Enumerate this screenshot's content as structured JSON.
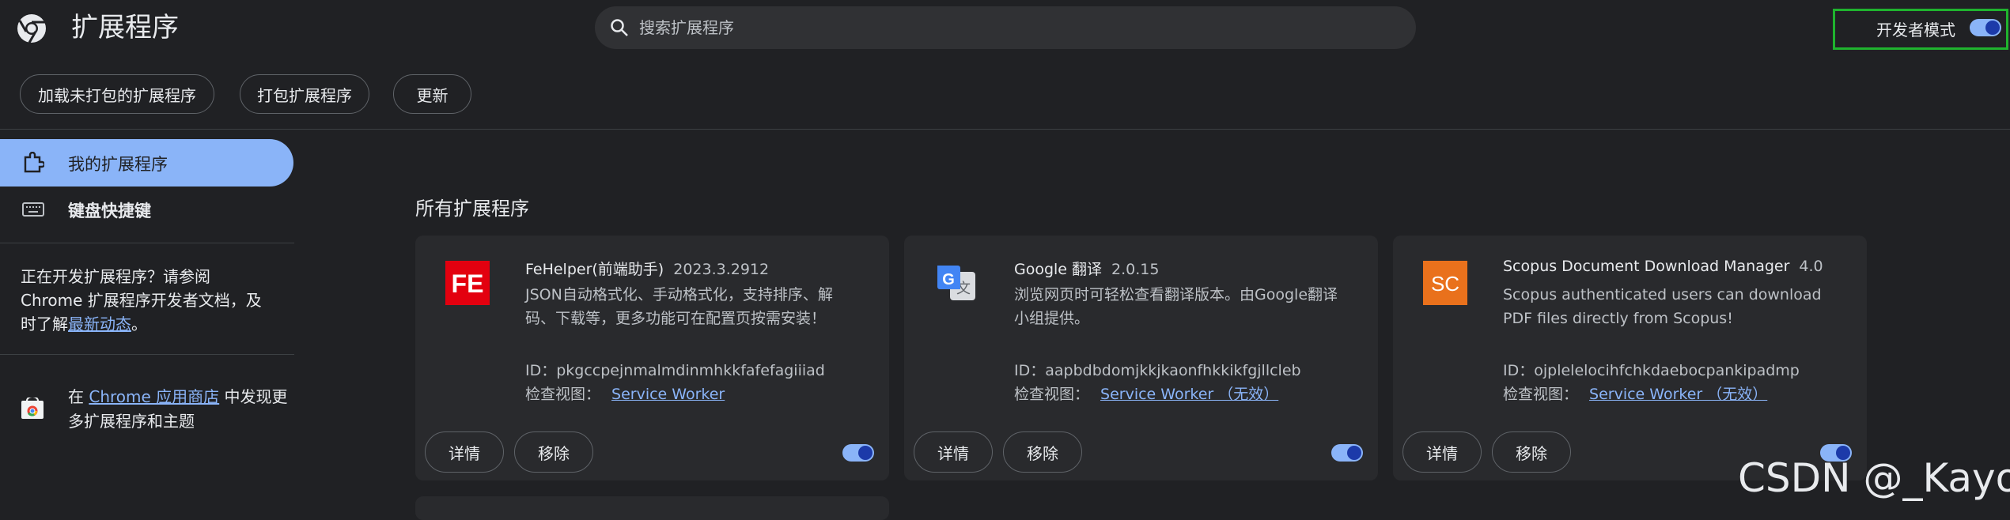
{
  "header": {
    "title": "扩展程序",
    "search_placeholder": "搜索扩展程序",
    "dev_mode_label": "开发者模式",
    "dev_mode_on": true
  },
  "toolbar": {
    "load_unpacked": "加载未打包的扩展程序",
    "pack": "打包扩展程序",
    "update": "更新"
  },
  "sidebar": {
    "items": [
      {
        "label": "我的扩展程序",
        "active": true
      },
      {
        "label": "键盘快捷键",
        "active": false
      }
    ],
    "dev_text_pre": "正在开发扩展程序？请参阅 Chrome 扩展程序开发者文档，及时了解",
    "dev_link": "最新动态",
    "dev_text_post": "。",
    "store_pre": "在 ",
    "store_link": "Chrome 应用商店",
    "store_post": " 中发现更多扩展程序和主题"
  },
  "main": {
    "section_title": "所有扩展程序",
    "cards": [
      {
        "name": "FeHelper(前端助手)",
        "version": "2023.3.2912",
        "description": "JSON自动格式化、手动格式化，支持排序、解码、下载等，更多功能可在配置页按需安装！",
        "id_label": "ID：",
        "id": "pkgccpejnmalmdinmhkkfafefagiiiad",
        "inspect_label": "检查视图：",
        "inspect_link": "Service Worker",
        "details": "详情",
        "remove": "移除",
        "enabled": true,
        "icon": "fehelper-icon"
      },
      {
        "name": "Google 翻译",
        "version": "2.0.15",
        "description": "浏览网页时可轻松查看翻译版本。由Google翻译小组提供。",
        "id_label": "ID：",
        "id": "aapbdbdomjkkjkaonfhkkikfgjllcleb",
        "inspect_label": "检查视图：",
        "inspect_link": "Service Worker （无效）",
        "details": "详情",
        "remove": "移除",
        "enabled": true,
        "icon": "google-translate-icon"
      },
      {
        "name": "Scopus Document Download Manager",
        "version": "4.0",
        "description": "Scopus authenticated users can download PDF files directly from Scopus!",
        "id_label": "ID：",
        "id": "ojplelelocihfchkdaebocpankipadmp",
        "inspect_label": "检查视图：",
        "inspect_link": "Service Worker （无效）",
        "details": "详情",
        "remove": "移除",
        "enabled": true,
        "icon": "scopus-icon",
        "icon_text": "SC"
      }
    ]
  },
  "watermark": "CSDN @_Kayo_",
  "colors": {
    "background": "#202124",
    "card": "#292a2d",
    "accent": "#8ab4f8",
    "dev_mode_highlight": "#1fb32e",
    "scopus_orange": "#e9711c",
    "fehelper_red": "#e3000f"
  }
}
